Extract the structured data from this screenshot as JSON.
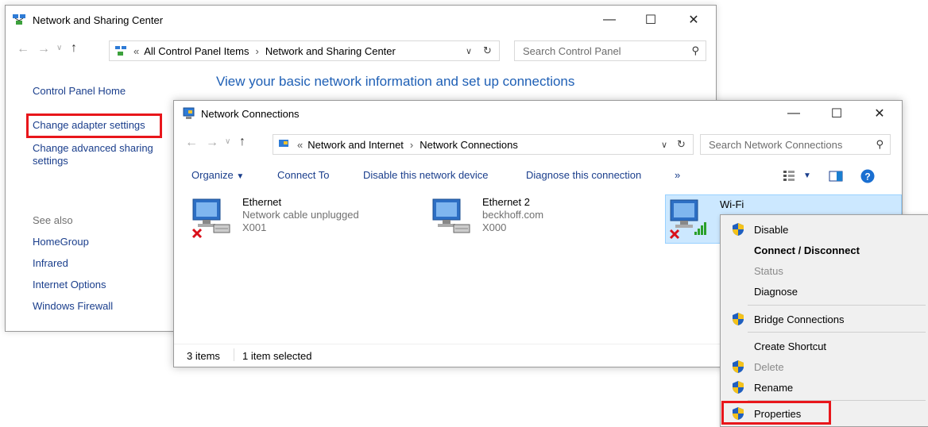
{
  "colors": {
    "highlight": "#e8161b",
    "link": "#1a3e8c",
    "heading": "#1e5fb5",
    "selection": "#cce8ff"
  },
  "nsc": {
    "title": "Network and Sharing Center",
    "breadcrumb": [
      "All Control Panel Items",
      "Network and Sharing Center"
    ],
    "breadcrumb_prefix": "«",
    "search_placeholder": "Search Control Panel",
    "heading": "View your basic network information and set up connections",
    "sidebar": {
      "home": "Control Panel Home",
      "change_adapter": "Change adapter settings",
      "change_sharing_1": "Change advanced sharing",
      "change_sharing_2": "settings",
      "see_also": "See also",
      "links": [
        "HomeGroup",
        "Infrared",
        "Internet Options",
        "Windows Firewall"
      ]
    }
  },
  "nc": {
    "title": "Network Connections",
    "breadcrumb": [
      "Network and Internet",
      "Network Connections"
    ],
    "breadcrumb_prefix": "«",
    "search_placeholder": "Search Network Connections",
    "commands": {
      "organize": "Organize",
      "connect_to": "Connect To",
      "disable_device": "Disable this network device",
      "diagnose": "Diagnose this connection",
      "more": "»"
    },
    "connections": [
      {
        "name": "Ethernet",
        "status": "Network cable unplugged",
        "device": "X001",
        "icon": "ethernet-disconnected-icon"
      },
      {
        "name": "Ethernet 2",
        "status": "beckhoff.com",
        "device": "X000",
        "icon": "ethernet-icon"
      },
      {
        "name": "Wi-Fi",
        "status": "",
        "device": "",
        "icon": "wifi-disconnected-icon",
        "selected": true
      }
    ],
    "status_bar": {
      "items": "3 items",
      "selected": "1 item selected"
    }
  },
  "context_menu": {
    "items": [
      {
        "label": "Disable",
        "shield": true,
        "enabled": true,
        "bold": false
      },
      {
        "label": "Connect / Disconnect",
        "shield": false,
        "enabled": true,
        "bold": true
      },
      {
        "label": "Status",
        "shield": false,
        "enabled": false,
        "bold": false
      },
      {
        "label": "Diagnose",
        "shield": false,
        "enabled": true,
        "bold": false
      },
      {
        "label": "Bridge Connections",
        "shield": true,
        "enabled": true,
        "bold": false
      },
      {
        "label": "Create Shortcut",
        "shield": false,
        "enabled": true,
        "bold": false
      },
      {
        "label": "Delete",
        "shield": true,
        "enabled": false,
        "bold": false
      },
      {
        "label": "Rename",
        "shield": true,
        "enabled": true,
        "bold": false
      },
      {
        "label": "Properties",
        "shield": true,
        "enabled": true,
        "bold": false
      }
    ]
  }
}
